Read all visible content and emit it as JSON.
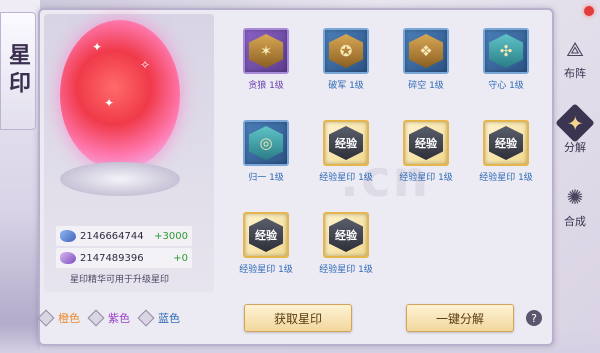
{
  "title": "星印",
  "resources": [
    {
      "icon": "blue-crystal-icon",
      "value": "2146664744",
      "gain": "+3000"
    },
    {
      "icon": "purple-crystal-icon",
      "value": "2147489396",
      "gain": "+0"
    }
  ],
  "tip": "星印精华可用于升级星印",
  "filters": [
    {
      "label": "橙色",
      "color": "#e88a2e"
    },
    {
      "label": "紫色",
      "color": "#9b44c7"
    },
    {
      "label": "蓝色",
      "color": "#2f6bb8"
    }
  ],
  "items": [
    {
      "label": "贪狼 1级",
      "rarity": "purple",
      "icon": "tanlang-emblem-icon"
    },
    {
      "label": "破军 1级",
      "rarity": "blue",
      "icon": "pojun-emblem-icon"
    },
    {
      "label": "碎空 1级",
      "rarity": "blue",
      "icon": "suikong-emblem-icon"
    },
    {
      "label": "守心 1级",
      "rarity": "blue",
      "icon": "shouxin-emblem-icon"
    },
    {
      "label": "归一 1级",
      "rarity": "blue",
      "icon": "guiyi-emblem-icon"
    },
    {
      "label": "经验星印 1级",
      "rarity": "gold",
      "icon": "exp-star-seal-icon",
      "glyph": "经验"
    },
    {
      "label": "经验星印 1级",
      "rarity": "gold",
      "icon": "exp-star-seal-icon",
      "glyph": "经验"
    },
    {
      "label": "经验星印 1级",
      "rarity": "gold",
      "icon": "exp-star-seal-icon",
      "glyph": "经验"
    },
    {
      "label": "经验星印 1级",
      "rarity": "gold",
      "icon": "exp-star-seal-icon",
      "glyph": "经验"
    },
    {
      "label": "经验星印 1级",
      "rarity": "gold",
      "icon": "exp-star-seal-icon",
      "glyph": "经验"
    }
  ],
  "buttons": {
    "get": "获取星印",
    "decompose_all": "一键分解",
    "help": "?"
  },
  "tabs": [
    {
      "label": "布阵",
      "icon": "formation-icon"
    },
    {
      "label": "分解",
      "icon": "decompose-icon",
      "active": true
    },
    {
      "label": "合成",
      "icon": "synthesize-icon"
    }
  ]
}
